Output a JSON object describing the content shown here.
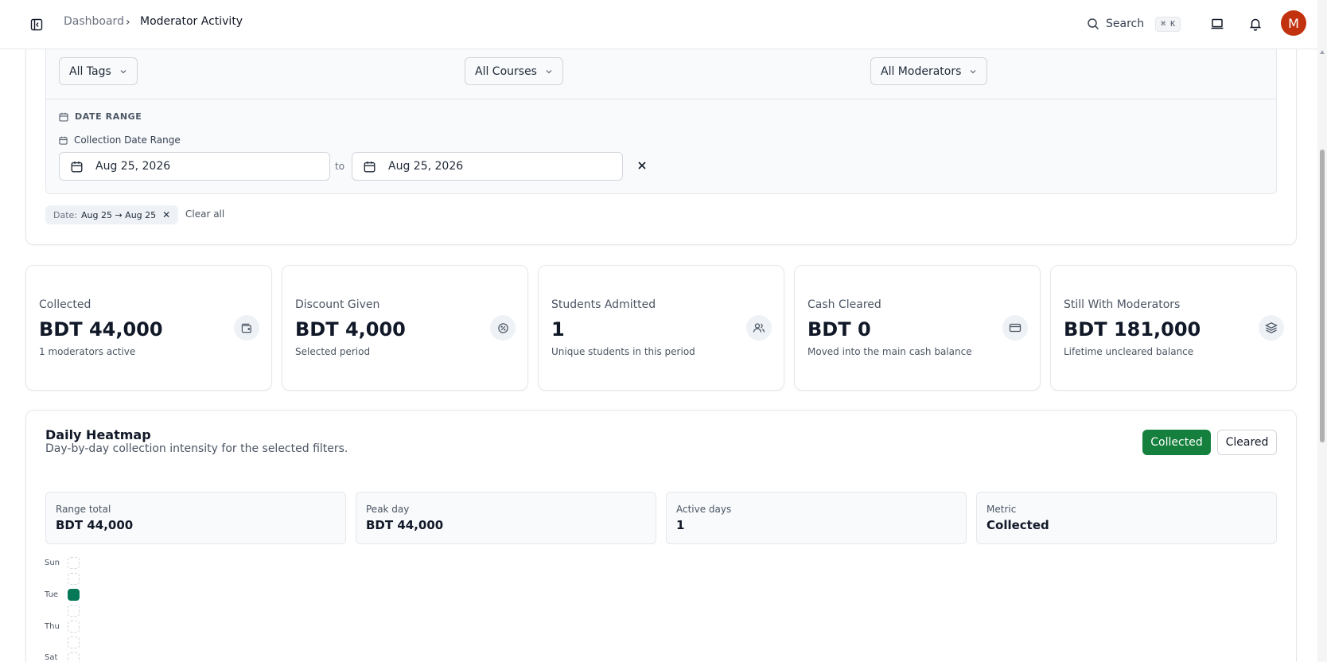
{
  "breadcrumb": {
    "home": "Dashboard",
    "separator": "›",
    "current": "Moderator Activity"
  },
  "header": {
    "search_label": "Search",
    "search_shortcut": "⌘ K",
    "avatar_initial": "M"
  },
  "filters": {
    "tags_select": "All Tags",
    "courses_select": "All Courses",
    "moderators_select": "All Moderators",
    "date_range_heading": "DATE RANGE",
    "date_range_label": "Collection Date Range",
    "date_from": "Aug 25, 2026",
    "date_to_label": "to",
    "date_to": "Aug 25, 2026",
    "active_chip_key": "Date:",
    "active_chip_value": "Aug 25 → Aug 25",
    "clear_all": "Clear all"
  },
  "stats": [
    {
      "title": "Collected",
      "value": "BDT 44,000",
      "sub": "1 moderators active",
      "icon": "wallet-icon"
    },
    {
      "title": "Discount Given",
      "value": "BDT 4,000",
      "sub": "Selected period",
      "icon": "discount-icon"
    },
    {
      "title": "Students Admitted",
      "value": "1",
      "sub": "Unique students in this period",
      "icon": "users-icon"
    },
    {
      "title": "Cash Cleared",
      "value": "BDT 0",
      "sub": "Moved into the main cash balance",
      "icon": "credit-card-icon"
    },
    {
      "title": "Still With Moderators",
      "value": "BDT 181,000",
      "sub": "Lifetime uncleared balance",
      "icon": "layers-icon"
    }
  ],
  "heatmap": {
    "title": "Daily Heatmap",
    "description": "Day-by-day collection intensity for the selected filters.",
    "toggle_collected": "Collected",
    "toggle_cleared": "Cleared",
    "summary": [
      {
        "label": "Range total",
        "value": "BDT 44,000"
      },
      {
        "label": "Peak day",
        "value": "BDT 44,000"
      },
      {
        "label": "Active days",
        "value": "1"
      },
      {
        "label": "Metric",
        "value": "Collected"
      }
    ],
    "day_labels": [
      "Sun",
      "Tue",
      "Thu",
      "Sat"
    ],
    "active_day": "Tue",
    "accent_color": "#047857"
  },
  "colors": {
    "primary_green": "#15803d",
    "avatar_bg": "#c2320f"
  }
}
